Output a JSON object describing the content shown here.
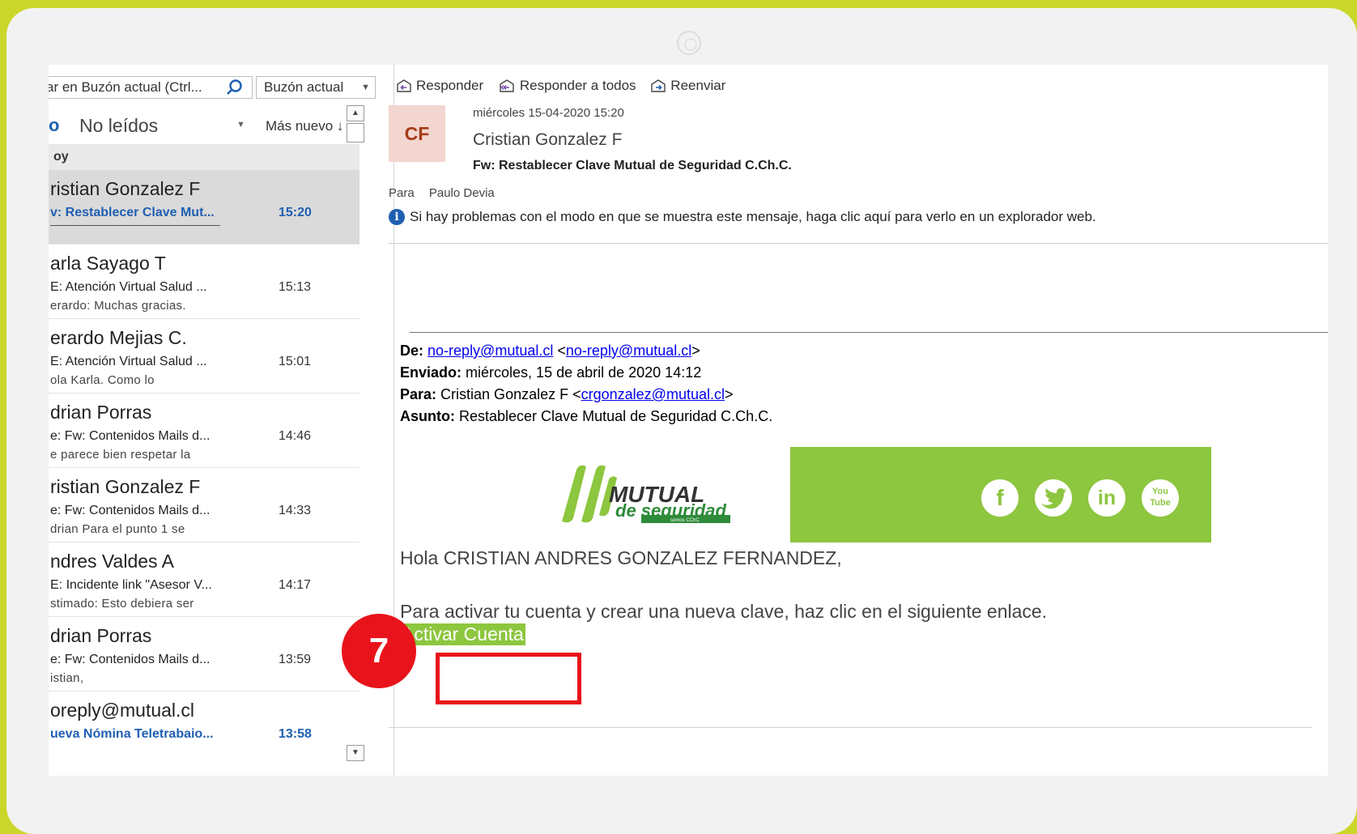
{
  "search": {
    "placeholder": "ar en Buzón actual (Ctrl...",
    "scope": "Buzón actual"
  },
  "filter": {
    "all_label": "o",
    "unread_label": "No leídos",
    "sort_label": "Más nuevo ↓"
  },
  "group_header": "oy",
  "messages": [
    {
      "sender": "ristian Gonzalez F",
      "subject": "v: Restablecer Clave Mut...",
      "time": "15:20",
      "preview": ""
    },
    {
      "sender": "arla Sayago T",
      "subject": "E: Atención Virtual Salud ...",
      "time": "15:13",
      "preview": "erardo:  Muchas gracias."
    },
    {
      "sender": "erardo Mejias C.",
      "subject": "E: Atención Virtual Salud ...",
      "time": "15:01",
      "preview": "ola Karla. Como lo"
    },
    {
      "sender": "drian Porras",
      "subject": "e: Fw: Contenidos Mails d...",
      "time": "14:46",
      "preview": "e parece bien respetar la"
    },
    {
      "sender": "ristian Gonzalez F",
      "subject": "e: Fw: Contenidos Mails d...",
      "time": "14:33",
      "preview": "drian  Para el punto 1 se"
    },
    {
      "sender": "ndres Valdes A",
      "subject": "E: Incidente link \"Asesor V...",
      "time": "14:17",
      "preview": "stimado:  Esto debiera ser"
    },
    {
      "sender": "drian Porras",
      "subject": "e: Fw: Contenidos Mails d...",
      "time": "13:59",
      "preview": "istian,"
    },
    {
      "sender": "oreply@mutual.cl",
      "subject": "ueva Nómina Teletrabaio...",
      "time": "13:58",
      "preview": ""
    }
  ],
  "actions": {
    "reply": "Responder",
    "reply_all": "Responder a todos",
    "forward": "Reenviar"
  },
  "email": {
    "avatar_initials": "CF",
    "date": "miércoles 15-04-2020 15:20",
    "from_name": "Cristian Gonzalez F",
    "subject": "Fw: Restablecer Clave Mutual de Seguridad C.Ch.C.",
    "to_label": "Para",
    "to_name": "Paulo Devia",
    "info_notice": "Si hay problemas con el modo en que se muestra este mensaje, haga clic aquí para verlo en un explorador web.",
    "fwd": {
      "de_label": "De:",
      "de_link1": "no-reply@mutual.cl",
      "de_link2": "no-reply@mutual.cl",
      "enviado_label": "Enviado:",
      "enviado_value": "miércoles, 15 de abril de 2020 14:12",
      "para_label": "Para:",
      "para_name": "Cristian Gonzalez F",
      "para_link": "crgonzalez@mutual.cl",
      "asunto_label": "Asunto:",
      "asunto_value": "Restablecer Clave Mutual de Seguridad C.Ch.C."
    },
    "logo": {
      "line1": "MUTUAL",
      "line2": "de seguridad",
      "tag": "somos CChC"
    },
    "social": {
      "facebook": "f",
      "linkedin": "in",
      "youtube_top": "You",
      "youtube_bottom": "Tube"
    },
    "greeting": "Hola CRISTIAN ANDRES GONZALEZ FERNANDEZ,",
    "body": "Para activar tu cuenta y crear una nueva clave, haz clic en el siguiente enlace.",
    "activate_link": "Activar Cuenta"
  },
  "annotation": {
    "step_number": "7"
  },
  "colors": {
    "frame": "#cbd62a",
    "brand_green": "#8dc63f",
    "highlight_red": "#e8131b",
    "outlook_blue": "#1f5fb1"
  }
}
